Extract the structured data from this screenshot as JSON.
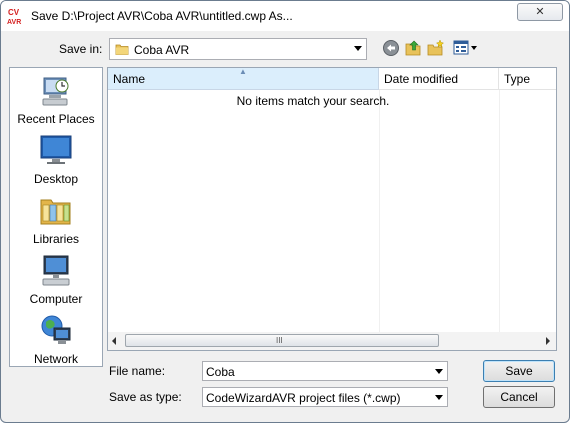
{
  "window": {
    "title": "Save D:\\Project AVR\\Coba AVR\\untitled.cwp As...",
    "app_icon_text": "CV AVR",
    "close_label": "✕"
  },
  "toolbar": {
    "save_in_label": "Save in:",
    "save_in_value": "Coba AVR",
    "back_icon": "back-arrow-icon",
    "up_icon": "up-folder-icon",
    "new_folder_icon": "new-folder-icon",
    "views_icon": "views-menu-icon"
  },
  "places": [
    {
      "label": "Recent Places",
      "icon": "recent-places-icon"
    },
    {
      "label": "Desktop",
      "icon": "desktop-icon"
    },
    {
      "label": "Libraries",
      "icon": "libraries-icon"
    },
    {
      "label": "Computer",
      "icon": "computer-icon"
    },
    {
      "label": "Network",
      "icon": "network-icon"
    }
  ],
  "file_list": {
    "columns": [
      "Name",
      "Date modified",
      "Type"
    ],
    "empty_message": "No items match your search.",
    "scroll_grip": "III"
  },
  "form": {
    "file_name_label": "File name:",
    "file_name_value": "Coba",
    "save_as_type_label": "Save as type:",
    "save_as_type_value": "CodeWizardAVR project files (*.cwp)"
  },
  "buttons": {
    "save": "Save",
    "cancel": "Cancel"
  },
  "colors": {
    "accent": "#dbeefc",
    "app_icon_red": "#d42020"
  }
}
